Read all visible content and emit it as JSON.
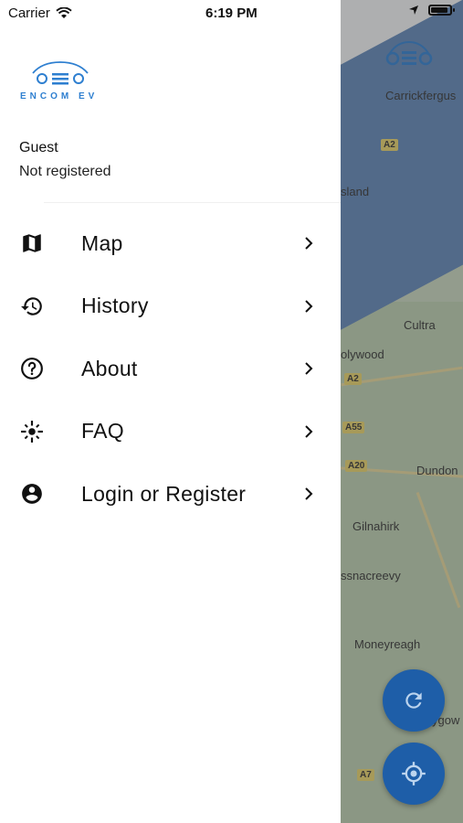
{
  "status_bar": {
    "carrier": "Carrier",
    "time": "6:19 PM"
  },
  "brand": {
    "logo_text": "ENCOM EV",
    "accent": "#2e7fd0"
  },
  "user": {
    "name": "Guest",
    "status": "Not registered"
  },
  "menu": [
    {
      "label": "Map",
      "icon": "map-icon"
    },
    {
      "label": "History",
      "icon": "history-icon"
    },
    {
      "label": "About",
      "icon": "help-circle-icon"
    },
    {
      "label": "FAQ",
      "icon": "spark-icon"
    },
    {
      "label": "Login or Register",
      "icon": "account-circle-icon"
    }
  ],
  "map": {
    "places": [
      "Carrickfergus",
      "sland",
      "Cultra",
      "olywood",
      "Dundon",
      "Gilnahirk",
      "ssnacreevy",
      "Moneyreagh",
      "ygow"
    ],
    "road_shields": [
      "A2",
      "A2",
      "A55",
      "A20",
      "A7"
    ]
  },
  "colors": {
    "fab": "#1e5ea8",
    "water": "#5f86b9",
    "land": "#c9d7bf"
  }
}
